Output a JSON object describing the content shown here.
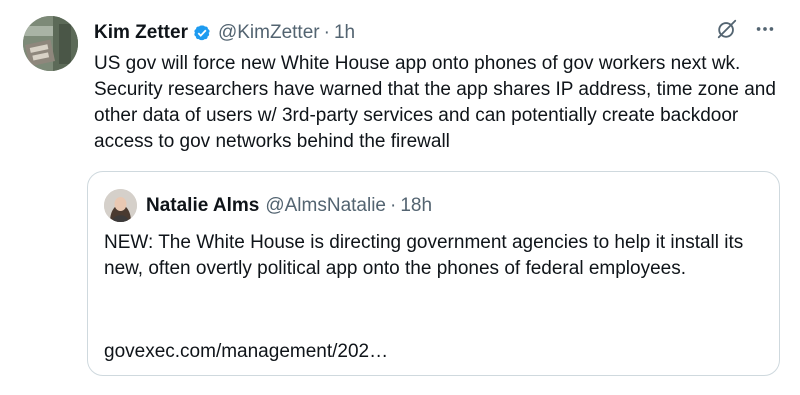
{
  "tweet": {
    "author_name": "Kim Zetter",
    "author_handle": "@KimZetter",
    "separator": "·",
    "time": "1h",
    "text": "US gov will force new White House app onto phones of gov workers next wk. Security researchers have warned that the app shares IP address, time zone and other data of users w/ 3rd-party services and can potentially create backdoor access to gov networks behind the firewall",
    "verified_color": "#1d9bf0",
    "icons": [
      "grok-icon",
      "more-icon"
    ]
  },
  "quote": {
    "author_name": "Natalie Alms",
    "author_handle": "@AlmsNatalie",
    "separator": "·",
    "time": "18h",
    "text": "NEW: The White House is directing government agencies to help it install its new, often overtly political app onto the phones of federal employees.",
    "link": "govexec.com/management/202…"
  },
  "colors": {
    "text": "#0f1419",
    "secondary": "#536471",
    "border": "#cfd9de"
  }
}
